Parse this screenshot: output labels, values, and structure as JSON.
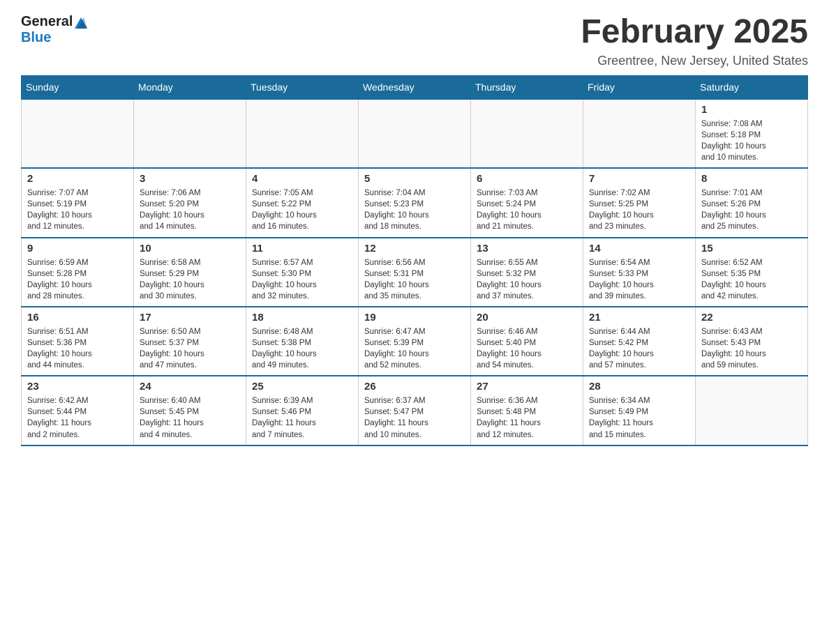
{
  "header": {
    "logo_general": "General",
    "logo_blue": "Blue",
    "month_title": "February 2025",
    "location": "Greentree, New Jersey, United States"
  },
  "days_of_week": [
    "Sunday",
    "Monday",
    "Tuesday",
    "Wednesday",
    "Thursday",
    "Friday",
    "Saturday"
  ],
  "weeks": [
    [
      {
        "day": "",
        "info": ""
      },
      {
        "day": "",
        "info": ""
      },
      {
        "day": "",
        "info": ""
      },
      {
        "day": "",
        "info": ""
      },
      {
        "day": "",
        "info": ""
      },
      {
        "day": "",
        "info": ""
      },
      {
        "day": "1",
        "info": "Sunrise: 7:08 AM\nSunset: 5:18 PM\nDaylight: 10 hours\nand 10 minutes."
      }
    ],
    [
      {
        "day": "2",
        "info": "Sunrise: 7:07 AM\nSunset: 5:19 PM\nDaylight: 10 hours\nand 12 minutes."
      },
      {
        "day": "3",
        "info": "Sunrise: 7:06 AM\nSunset: 5:20 PM\nDaylight: 10 hours\nand 14 minutes."
      },
      {
        "day": "4",
        "info": "Sunrise: 7:05 AM\nSunset: 5:22 PM\nDaylight: 10 hours\nand 16 minutes."
      },
      {
        "day": "5",
        "info": "Sunrise: 7:04 AM\nSunset: 5:23 PM\nDaylight: 10 hours\nand 18 minutes."
      },
      {
        "day": "6",
        "info": "Sunrise: 7:03 AM\nSunset: 5:24 PM\nDaylight: 10 hours\nand 21 minutes."
      },
      {
        "day": "7",
        "info": "Sunrise: 7:02 AM\nSunset: 5:25 PM\nDaylight: 10 hours\nand 23 minutes."
      },
      {
        "day": "8",
        "info": "Sunrise: 7:01 AM\nSunset: 5:26 PM\nDaylight: 10 hours\nand 25 minutes."
      }
    ],
    [
      {
        "day": "9",
        "info": "Sunrise: 6:59 AM\nSunset: 5:28 PM\nDaylight: 10 hours\nand 28 minutes."
      },
      {
        "day": "10",
        "info": "Sunrise: 6:58 AM\nSunset: 5:29 PM\nDaylight: 10 hours\nand 30 minutes."
      },
      {
        "day": "11",
        "info": "Sunrise: 6:57 AM\nSunset: 5:30 PM\nDaylight: 10 hours\nand 32 minutes."
      },
      {
        "day": "12",
        "info": "Sunrise: 6:56 AM\nSunset: 5:31 PM\nDaylight: 10 hours\nand 35 minutes."
      },
      {
        "day": "13",
        "info": "Sunrise: 6:55 AM\nSunset: 5:32 PM\nDaylight: 10 hours\nand 37 minutes."
      },
      {
        "day": "14",
        "info": "Sunrise: 6:54 AM\nSunset: 5:33 PM\nDaylight: 10 hours\nand 39 minutes."
      },
      {
        "day": "15",
        "info": "Sunrise: 6:52 AM\nSunset: 5:35 PM\nDaylight: 10 hours\nand 42 minutes."
      }
    ],
    [
      {
        "day": "16",
        "info": "Sunrise: 6:51 AM\nSunset: 5:36 PM\nDaylight: 10 hours\nand 44 minutes."
      },
      {
        "day": "17",
        "info": "Sunrise: 6:50 AM\nSunset: 5:37 PM\nDaylight: 10 hours\nand 47 minutes."
      },
      {
        "day": "18",
        "info": "Sunrise: 6:48 AM\nSunset: 5:38 PM\nDaylight: 10 hours\nand 49 minutes."
      },
      {
        "day": "19",
        "info": "Sunrise: 6:47 AM\nSunset: 5:39 PM\nDaylight: 10 hours\nand 52 minutes."
      },
      {
        "day": "20",
        "info": "Sunrise: 6:46 AM\nSunset: 5:40 PM\nDaylight: 10 hours\nand 54 minutes."
      },
      {
        "day": "21",
        "info": "Sunrise: 6:44 AM\nSunset: 5:42 PM\nDaylight: 10 hours\nand 57 minutes."
      },
      {
        "day": "22",
        "info": "Sunrise: 6:43 AM\nSunset: 5:43 PM\nDaylight: 10 hours\nand 59 minutes."
      }
    ],
    [
      {
        "day": "23",
        "info": "Sunrise: 6:42 AM\nSunset: 5:44 PM\nDaylight: 11 hours\nand 2 minutes."
      },
      {
        "day": "24",
        "info": "Sunrise: 6:40 AM\nSunset: 5:45 PM\nDaylight: 11 hours\nand 4 minutes."
      },
      {
        "day": "25",
        "info": "Sunrise: 6:39 AM\nSunset: 5:46 PM\nDaylight: 11 hours\nand 7 minutes."
      },
      {
        "day": "26",
        "info": "Sunrise: 6:37 AM\nSunset: 5:47 PM\nDaylight: 11 hours\nand 10 minutes."
      },
      {
        "day": "27",
        "info": "Sunrise: 6:36 AM\nSunset: 5:48 PM\nDaylight: 11 hours\nand 12 minutes."
      },
      {
        "day": "28",
        "info": "Sunrise: 6:34 AM\nSunset: 5:49 PM\nDaylight: 11 hours\nand 15 minutes."
      },
      {
        "day": "",
        "info": ""
      }
    ]
  ]
}
